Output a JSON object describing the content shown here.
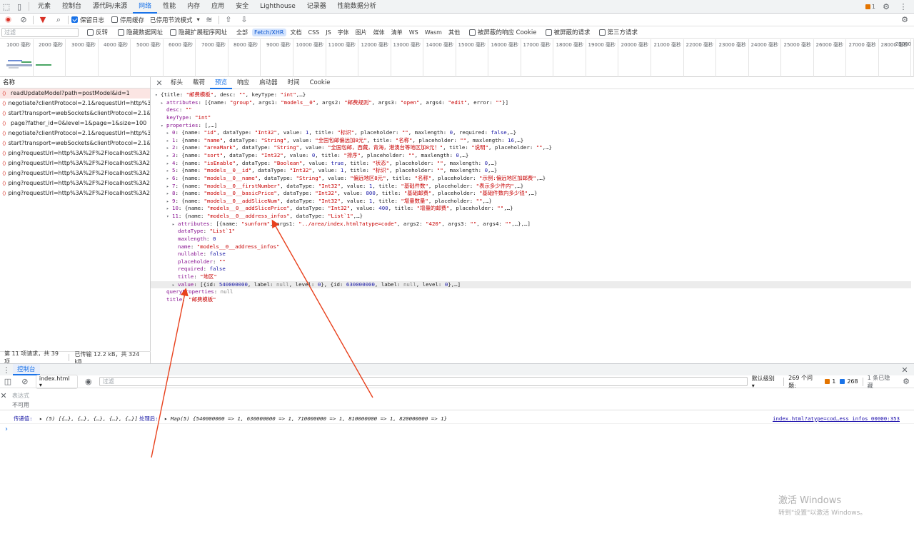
{
  "top_tabs": [
    "元素",
    "控制台",
    "源代码/来源",
    "网络",
    "性能",
    "内存",
    "应用",
    "安全",
    "Lighthouse",
    "记录器",
    "性能数据分析"
  ],
  "top_right": {
    "issue_count": "1"
  },
  "toolbar": {
    "preserve_log": "保留日志",
    "disable_cache": "停用缓存",
    "throttle": "已停用节流模式"
  },
  "filterbar": {
    "placeholder": "过滤",
    "invert": "反转",
    "hide_data_urls": "隐藏数据网址",
    "hide_ext_urls": "隐藏扩展程序网址",
    "types": [
      "全部",
      "Fetch/XHR",
      "文档",
      "CSS",
      "JS",
      "字体",
      "图片",
      "媒体",
      "清单",
      "WS",
      "Wasm",
      "其他"
    ],
    "blocked_cookies": "被屏蔽的响应 Cookie",
    "blocked_requests": "被屏蔽的请求",
    "third_party": "第三方请求"
  },
  "timeline_ticks": [
    "1000 毫秒",
    "2000 毫秒",
    "3000 毫秒",
    "4000 毫秒",
    "5000 毫秒",
    "6000 毫秒",
    "7000 毫秒",
    "8000 毫秒",
    "9000 毫秒",
    "10000 毫秒",
    "11000 毫秒",
    "12000 毫秒",
    "13000 毫秒",
    "14000 毫秒",
    "15000 毫秒",
    "16000 毫秒",
    "17000 毫秒",
    "18000 毫秒",
    "19000 毫秒",
    "20000 毫秒",
    "21000 毫秒",
    "22000 毫秒",
    "23000 毫秒",
    "24000 毫秒",
    "25000 毫秒",
    "26000 毫秒",
    "27000 毫秒",
    "28000 毫秒",
    "29000"
  ],
  "requests": {
    "header": "名称",
    "items": [
      "readUpdateModel?path=postModel&id=1",
      "negotiate?clientProtocol=2.1&requestUrl=http%3A...",
      "start?transport=webSockets&clientProtocol=2.1&re...",
      "page?father_id=0&level=1&page=1&size=100",
      "negotiate?clientProtocol=2.1&requestUrl=http%3A...",
      "start?transport=webSockets&clientProtocol=2.1&re...",
      "ping?requestUrl=http%3A%2F%2Flocalhost%3A2876...",
      "ping?requestUrl=http%3A%2F%2Flocalhost%3A2876...",
      "ping?requestUrl=http%3A%2F%2Flocalhost%3A2876...",
      "ping?requestUrl=http%3A%2F%2Flocalhost%3A2876...",
      "ping?requestUrl=http%3A%2F%2Flocalhost%3A2876..."
    ],
    "status_count": "第 11 项请求，共 39 项",
    "status_size": "已传输 12.2 kB，共 324 kB"
  },
  "detail_tabs": [
    "标头",
    "载荷",
    "预览",
    "响应",
    "启动器",
    "时间",
    "Cookie"
  ],
  "preview_lines": [
    {
      "indent": 0,
      "tw": "▾",
      "html": "{title: <span class='s'>\"邮费模板\"</span>, desc: <span class='s'>\"\"</span>, keyType: <span class='s'>\"int\"</span>,…}"
    },
    {
      "indent": 1,
      "tw": "▸",
      "html": "<span class='k'>attributes</span>: [{name: <span class='s'>\"group\"</span>, args1: <span class='s'>\"models__0\"</span>, args2: <span class='s'>\"邮费规则\"</span>, args3: <span class='s'>\"open\"</span>, args4: <span class='s'>\"edit\"</span>, error: <span class='s'>\"\"</span>}]"
    },
    {
      "indent": 1,
      "tw": "",
      "html": "<span class='k'>desc</span>: <span class='s'>\"\"</span>"
    },
    {
      "indent": 1,
      "tw": "",
      "html": "<span class='k'>keyType</span>: <span class='s'>\"int\"</span>"
    },
    {
      "indent": 1,
      "tw": "▾",
      "html": "<span class='k'>properties</span>: [,…]"
    },
    {
      "indent": 2,
      "tw": "▸",
      "html": "<span class='k'>0</span>: {name: <span class='s'>\"id\"</span>, dataType: <span class='s'>\"Int32\"</span>, value: <span class='n'>1</span>, title: <span class='s'>\"标识\"</span>, placeholder: <span class='s'>\"\"</span>, maxlength: <span class='n'>0</span>, required: <span class='n'>false</span>,…}"
    },
    {
      "indent": 2,
      "tw": "▸",
      "html": "<span class='k'>1</span>: {name: <span class='s'>\"name\"</span>, dataType: <span class='s'>\"String\"</span>, value: <span class='s'>\"全国包邮偏远加8元\"</span>, title: <span class='s'>\"名称\"</span>, placeholder: <span class='s'>\"\"</span>, maxlength: <span class='n'>16</span>,…}"
    },
    {
      "indent": 2,
      "tw": "▸",
      "html": "<span class='k'>2</span>: {name: <span class='s'>\"areaMark\"</span>, dataType: <span class='s'>\"String\"</span>, value: <span class='s'>\"全国包邮，西藏，青海，港澳台等地区加8元！\"</span>, title: <span class='s'>\"说明\"</span>, placeholder: <span class='s'>\"\"</span>,…}"
    },
    {
      "indent": 2,
      "tw": "▸",
      "html": "<span class='k'>3</span>: {name: <span class='s'>\"sort\"</span>, dataType: <span class='s'>\"Int32\"</span>, value: <span class='n'>0</span>, title: <span class='s'>\"排序\"</span>, placeholder: <span class='s'>\"\"</span>, maxlength: <span class='n'>0</span>,…}"
    },
    {
      "indent": 2,
      "tw": "▸",
      "html": "<span class='k'>4</span>: {name: <span class='s'>\"isEnable\"</span>, dataType: <span class='s'>\"Boolean\"</span>, value: <span class='n'>true</span>, title: <span class='s'>\"状态\"</span>, placeholder: <span class='s'>\"\"</span>, maxlength: <span class='n'>0</span>,…}"
    },
    {
      "indent": 2,
      "tw": "▸",
      "html": "<span class='k'>5</span>: {name: <span class='s'>\"models__0__id\"</span>, dataType: <span class='s'>\"Int32\"</span>, value: <span class='n'>1</span>, title: <span class='s'>\"标识\"</span>, placeholder: <span class='s'>\"\"</span>, maxlength: <span class='n'>0</span>,…}"
    },
    {
      "indent": 2,
      "tw": "▸",
      "html": "<span class='k'>6</span>: {name: <span class='s'>\"models__0__name\"</span>, dataType: <span class='s'>\"String\"</span>, value: <span class='s'>\"偏远地区8元\"</span>, title: <span class='s'>\"名称\"</span>, placeholder: <span class='s'>\"示例:偏远地区加邮费\"</span>,…}"
    },
    {
      "indent": 2,
      "tw": "▸",
      "html": "<span class='k'>7</span>: {name: <span class='s'>\"models__0__firstNumber\"</span>, dataType: <span class='s'>\"Int32\"</span>, value: <span class='n'>1</span>, title: <span class='s'>\"基础件数\"</span>, placeholder: <span class='s'>\"表示多少件内\"</span>,…}"
    },
    {
      "indent": 2,
      "tw": "▸",
      "html": "<span class='k'>8</span>: {name: <span class='s'>\"models__0__basicPrice\"</span>, dataType: <span class='s'>\"Int32\"</span>, value: <span class='n'>800</span>, title: <span class='s'>\"基础邮费\"</span>, placeholder: <span class='s'>\"基础件数内多少钱\"</span>,…}"
    },
    {
      "indent": 2,
      "tw": "▸",
      "html": "<span class='k'>9</span>: {name: <span class='s'>\"models__0__addSliceNum\"</span>, dataType: <span class='s'>\"Int32\"</span>, value: <span class='n'>1</span>, title: <span class='s'>\"增量数量\"</span>, placeholder: <span class='s'>\"\"</span>,…}"
    },
    {
      "indent": 2,
      "tw": "▸",
      "html": "<span class='k'>10</span>: {name: <span class='s'>\"models__0__addSlicePrice\"</span>, dataType: <span class='s'>\"Int32\"</span>, value: <span class='n'>400</span>, title: <span class='s'>\"增量的邮费\"</span>, placeholder: <span class='s'>\"\"</span>,…}"
    },
    {
      "indent": 2,
      "tw": "▾",
      "html": "<span class='k'>11</span>: {name: <span class='s'>\"models__0__address_infos\"</span>, dataType: <span class='s'>\"List`1\"</span>,…}"
    },
    {
      "indent": 3,
      "tw": "▸",
      "html": "<span class='k'>attributes</span>: [{name: <span class='s'>\"sunform\"</span>, args1: <span class='s'>\"../area/index.html?atype=code\"</span>, args2: <span class='s'>\"420\"</span>, args3: <span class='s'>\"\"</span>, args4: <span class='s'>\"\"</span>,…},…]"
    },
    {
      "indent": 3,
      "tw": "",
      "html": "<span class='k'>dataType</span>: <span class='s'>\"List`1\"</span>"
    },
    {
      "indent": 3,
      "tw": "",
      "html": "<span class='k'>maxlength</span>: <span class='n'>0</span>"
    },
    {
      "indent": 3,
      "tw": "",
      "html": "<span class='k'>name</span>: <span class='s'>\"models__0__address_infos\"</span>"
    },
    {
      "indent": 3,
      "tw": "",
      "html": "<span class='k'>nullable</span>: <span class='n'>false</span>"
    },
    {
      "indent": 3,
      "tw": "",
      "html": "<span class='k'>placeholder</span>: <span class='s'>\"\"</span>"
    },
    {
      "indent": 3,
      "tw": "",
      "html": "<span class='k'>required</span>: <span class='n'>false</span>"
    },
    {
      "indent": 3,
      "tw": "",
      "html": "<span class='k'>title</span>: <span class='s'>\"地区\"</span>"
    },
    {
      "indent": 3,
      "tw": "▸",
      "html": "<span class='k'>value</span>: [{id: <span class='n'>540000000</span>, label: <span class='g'>null</span>, level: <span class='n'>0</span>}, {id: <span class='n'>630000000</span>, label: <span class='g'>null</span>, level: <span class='n'>0</span>},…]",
      "hl": true
    },
    {
      "indent": 1,
      "tw": "",
      "html": "<span class='k'>queryProperties</span>: <span class='g'>null</span>"
    },
    {
      "indent": 1,
      "tw": "",
      "html": "<span class='k'>title</span>: <span class='s'>\"邮费模板\"</span>"
    }
  ],
  "drawer": {
    "tab": "控制台",
    "context": "index.html",
    "filter_placeholder": "过滤",
    "level": "默认级别",
    "issues": "269 个问题:",
    "issues_warn": "1",
    "issues_info": "268",
    "hidden": "1 条已隐藏",
    "expr_label": "表达式",
    "expr_value": "不可用",
    "log_prefix": "传递值:",
    "log_arr": "(5) [{…}, {…}, {…}, {…}, {…}]",
    "log_after": "处理后:",
    "log_map": "Map(5) {540000000 => 1, 630000000 => 1, 710000000 => 1, 810000000 => 1, 820000000 => 1}",
    "log_source": "index.html?atype=cod…ess_infos_00000:353",
    "prompt": "›"
  },
  "watermark": {
    "line1": "激活 Windows",
    "line2": "转到\"设置\"以激活 Windows。"
  },
  "colors": {
    "accent": "#1a73e8",
    "annotation": "#e8401c"
  }
}
